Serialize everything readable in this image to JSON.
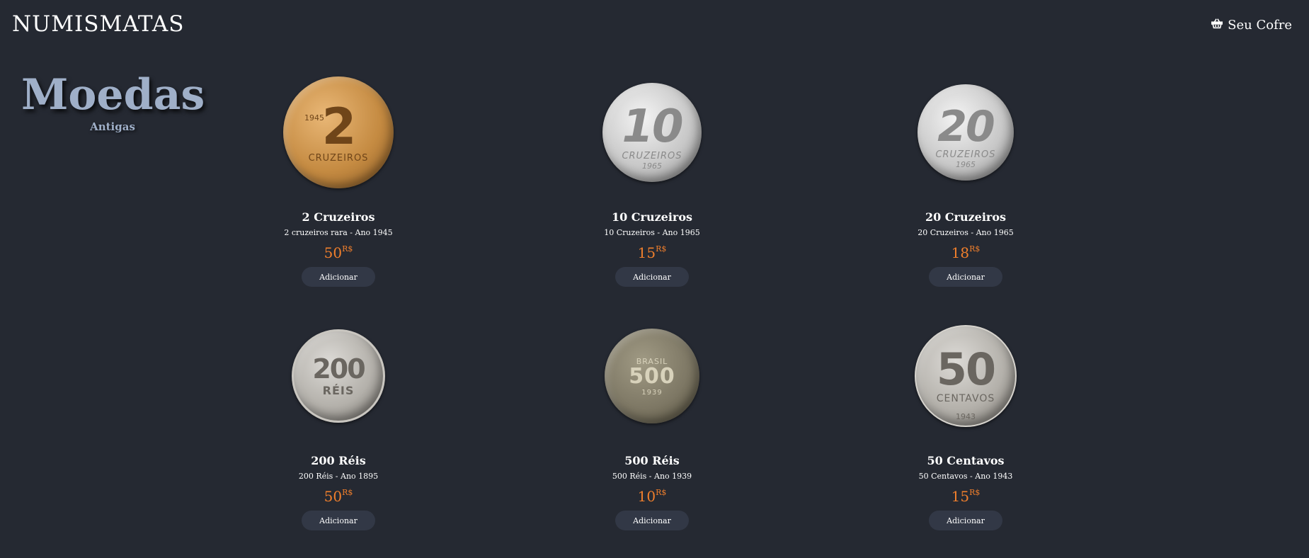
{
  "brand": "NUMISMATAS",
  "cart": {
    "label": "Seu Cofre",
    "icon": "basket-icon"
  },
  "hero": {
    "title": "Moedas",
    "subtitle": "Antigas"
  },
  "products": [
    {
      "title": "2 Cruzeiros",
      "description": "2 cruzeiros rara - Ano 1945",
      "price": "50",
      "currency": "R$",
      "button": "Adicionar",
      "coin_num": "2",
      "coin_text": "CRUZEIROS",
      "coin_year": "1945"
    },
    {
      "title": "10 Cruzeiros",
      "description": "10 Cruzeiros - Ano 1965",
      "price": "15",
      "currency": "R$",
      "button": "Adicionar",
      "coin_num": "10",
      "coin_text": "CRUZEIROS",
      "coin_year": "1965"
    },
    {
      "title": "20 Cruzeiros",
      "description": "20 Cruzeiros - Ano 1965",
      "price": "18",
      "currency": "R$",
      "button": "Adicionar",
      "coin_num": "20",
      "coin_text": "CRUZEIROS",
      "coin_year": "1965"
    },
    {
      "title": "200 Réis",
      "description": "200 Réis - Ano 1895",
      "price": "50",
      "currency": "R$",
      "button": "Adicionar",
      "coin_num": "200",
      "coin_text": "RÉIS",
      "coin_year": ""
    },
    {
      "title": "500 Réis",
      "description": "500 Réis - Ano 1939",
      "price": "10",
      "currency": "R$",
      "button": "Adicionar",
      "coin_num": "500",
      "coin_text": "BRASIL",
      "coin_year": "1939"
    },
    {
      "title": "50 Centavos",
      "description": "50 Centavos - Ano 1943",
      "price": "15",
      "currency": "R$",
      "button": "Adicionar",
      "coin_num": "50",
      "coin_text": "CENTAVOS",
      "coin_year": "1943"
    }
  ]
}
